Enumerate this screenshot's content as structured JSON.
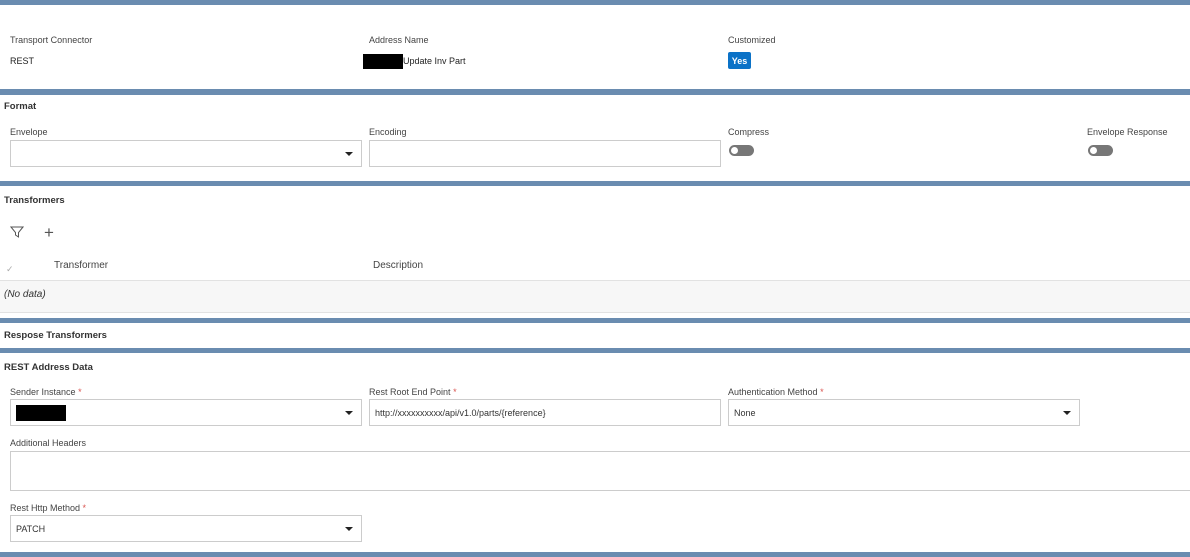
{
  "header": {
    "transport_connector_label": "Transport Connector",
    "transport_connector_value": "REST",
    "address_name_label": "Address Name",
    "address_name_value": "Update Inv Part",
    "customized_label": "Customized",
    "customized_value": "Yes"
  },
  "format": {
    "title": "Format",
    "envelope_label": "Envelope",
    "envelope_value": "",
    "encoding_label": "Encoding",
    "encoding_value": "",
    "compress_label": "Compress",
    "compress_on": false,
    "envelope_response_label": "Envelope Response",
    "envelope_response_on": false
  },
  "transformers": {
    "title": "Transformers",
    "columns": [
      "Transformer",
      "Description"
    ],
    "empty_text": "(No data)"
  },
  "response_transformers": {
    "title": "Respose Transformers"
  },
  "rest": {
    "title": "REST Address Data",
    "sender_instance_label": "Sender Instance",
    "rest_root_label": "Rest Root End Point",
    "rest_root_value": "http://xxxxxxxxxx/api/v1.0/parts/{reference}",
    "auth_label": "Authentication Method",
    "auth_value": "None",
    "headers_label": "Additional Headers",
    "headers_value": "",
    "http_method_label": "Rest Http Method",
    "http_method_value": "PATCH",
    "required_mark": "*"
  },
  "colors": {
    "accent": "#0b72c7",
    "section_bar": "#6a8cb0"
  }
}
